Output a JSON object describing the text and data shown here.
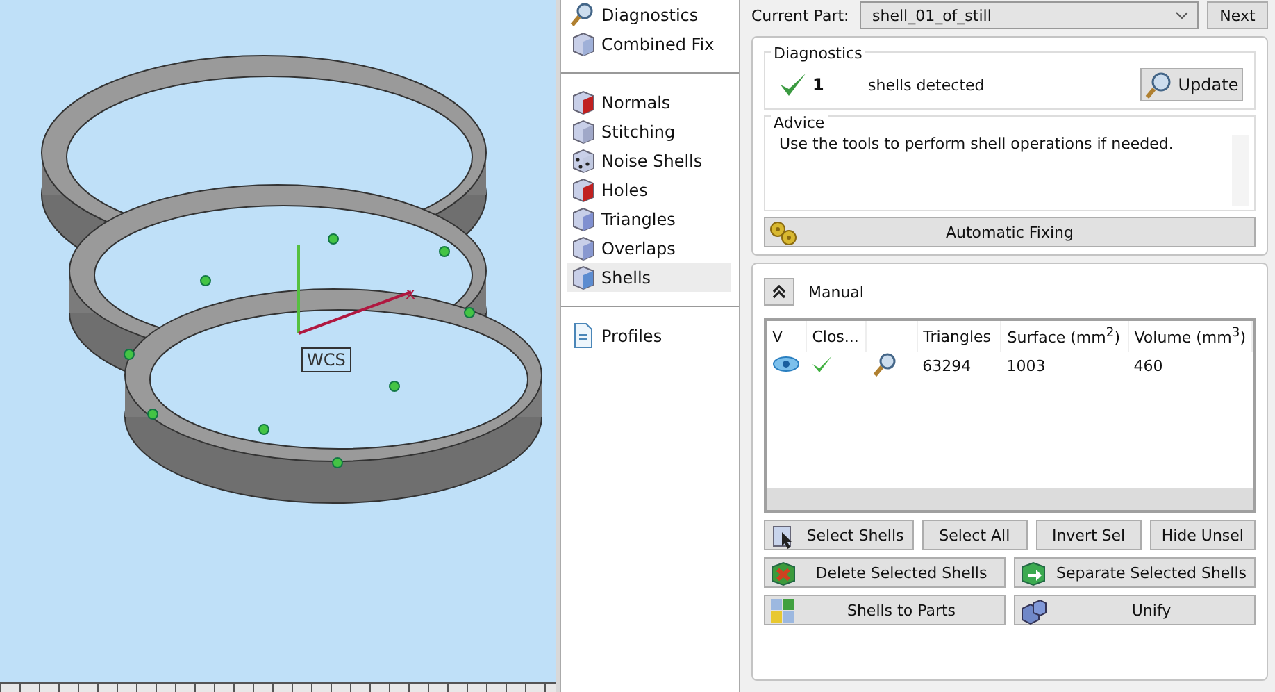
{
  "viewport": {
    "axis_x_label": "x",
    "axis_label": "WCS"
  },
  "sidebar": {
    "groups": [
      [
        {
          "label": "Diagnostics",
          "selected": false
        },
        {
          "label": "Combined Fix",
          "selected": false
        }
      ],
      [
        {
          "label": "Normals",
          "selected": false
        },
        {
          "label": "Stitching",
          "selected": false
        },
        {
          "label": "Noise Shells",
          "selected": false
        },
        {
          "label": "Holes",
          "selected": false
        },
        {
          "label": "Triangles",
          "selected": false
        },
        {
          "label": "Overlaps",
          "selected": false
        },
        {
          "label": "Shells",
          "selected": true
        }
      ],
      [
        {
          "label": "Profiles",
          "selected": false
        }
      ]
    ]
  },
  "current_part": {
    "label": "Current Part:",
    "value": "shell_01_of_still",
    "next_button": "Next"
  },
  "diagnostics": {
    "title": "Diagnostics",
    "ok": true,
    "count": "1",
    "text": "shells detected",
    "update_button": "Update"
  },
  "advice": {
    "title": "Advice",
    "text": "Use the tools to perform shell operations if needed."
  },
  "automatic_fixing_button": "Automatic Fixing",
  "manual": {
    "title": "Manual",
    "expanded": true,
    "table": {
      "columns": [
        "V",
        "Clos...",
        "",
        "Triangles",
        "Surface (mm$^{2}$)",
        "Volume (mm$^{3}$)"
      ],
      "rows": [
        {
          "visible": true,
          "closed": true,
          "triangles": "63294",
          "surface": "1003",
          "volume": "460"
        }
      ]
    },
    "buttons": [
      [
        "Select Shells",
        "Select All",
        "Invert Sel",
        "Hide Unsel"
      ],
      [
        "Delete Selected Shells",
        "Separate Selected Shells"
      ],
      [
        "Shells to Parts",
        "Unify"
      ]
    ]
  }
}
